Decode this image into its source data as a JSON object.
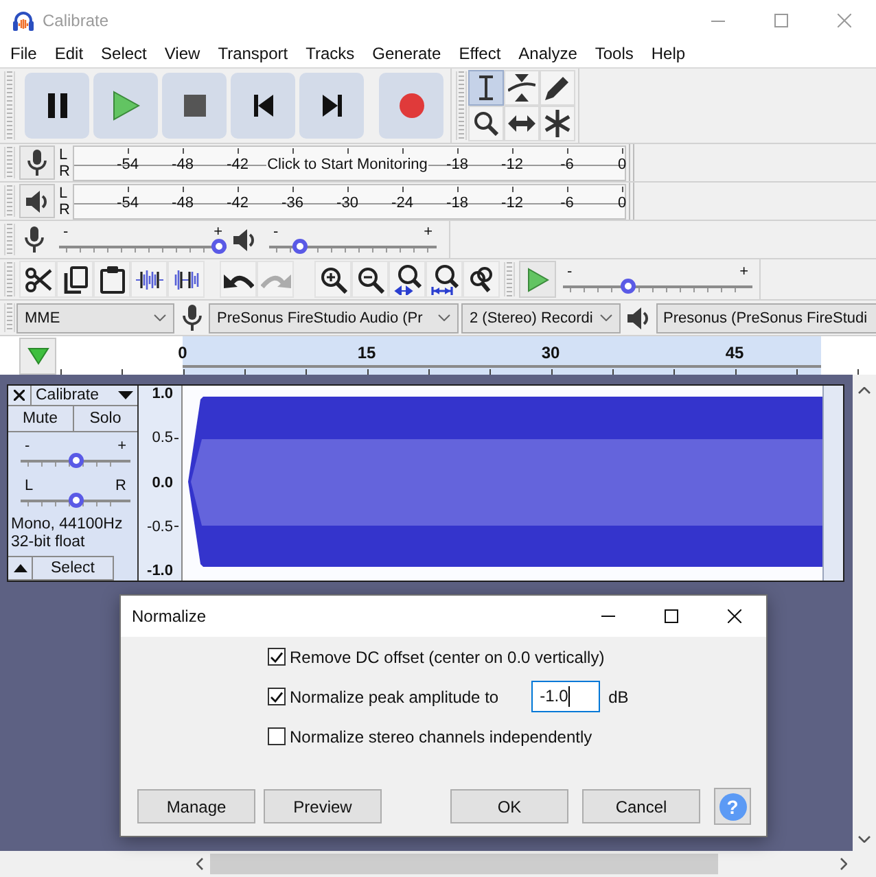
{
  "window": {
    "title": "Calibrate"
  },
  "menu": [
    "File",
    "Edit",
    "Select",
    "View",
    "Transport",
    "Tracks",
    "Generate",
    "Effect",
    "Analyze",
    "Tools",
    "Help"
  ],
  "tools": [
    {
      "kind": "select",
      "selected": true
    },
    {
      "kind": "envelope",
      "selected": false
    },
    {
      "kind": "draw",
      "selected": false
    },
    {
      "kind": "zoom",
      "selected": false
    },
    {
      "kind": "time-shift",
      "selected": false
    },
    {
      "kind": "multi",
      "selected": false
    }
  ],
  "recording_meter": {
    "channels": [
      "L",
      "R"
    ],
    "ticks": [
      "-54",
      "-48",
      "-42"
    ],
    "message": "Click to Start Monitoring",
    "ticks_end": [
      "-18",
      "-12",
      "-6",
      "0"
    ]
  },
  "playback_meter": {
    "channels": [
      "L",
      "R"
    ],
    "ticks": [
      "-54",
      "-48",
      "-42",
      "-36",
      "-30",
      "-24",
      "-18",
      "-12",
      "-6",
      "0"
    ]
  },
  "mixer": {
    "recording_volume": {
      "min_label": "-",
      "max_label": "+",
      "level": 1.0
    },
    "playback_volume": {
      "min_label": "-",
      "max_label": "+",
      "level": 0.15
    }
  },
  "edit_toolbar": [
    {
      "kind": "cut",
      "disabled": false
    },
    {
      "kind": "copy",
      "disabled": false
    },
    {
      "kind": "paste",
      "disabled": false
    },
    {
      "kind": "trim",
      "disabled": false
    },
    {
      "kind": "silence",
      "disabled": false
    },
    {
      "kind": "undo",
      "disabled": false
    },
    {
      "kind": "redo",
      "disabled": true
    },
    {
      "kind": "zoom-in",
      "disabled": false
    },
    {
      "kind": "zoom-out",
      "disabled": false
    },
    {
      "kind": "fit-selection",
      "disabled": false
    },
    {
      "kind": "fit-project",
      "disabled": false
    },
    {
      "kind": "zoom-toggle",
      "disabled": false
    }
  ],
  "play_at_speed": {
    "min_label": "-",
    "max_label": "+",
    "level": 0.33
  },
  "devices": {
    "host": "MME",
    "recording_device": "PreSonus FireStudio Audio (Pr",
    "recording_channels": "2 (Stereo) Recordi",
    "playback_device": "Presonus (PreSonus FireStudi"
  },
  "timeline": {
    "labels": [
      "0",
      "15",
      "30",
      "45"
    ]
  },
  "track": {
    "name": "Calibrate",
    "mute": "Mute",
    "solo": "Solo",
    "gain": {
      "min_label": "-",
      "max_label": "+",
      "level": 0.5
    },
    "pan": {
      "min_label": "L",
      "max_label": "R",
      "level": 0.5
    },
    "info": [
      "Mono, 44100Hz",
      "32-bit float"
    ],
    "select": "Select",
    "scale": [
      "1.0",
      "0.5",
      "0.0",
      "-0.5",
      "-1.0"
    ]
  },
  "dialog": {
    "title": "Normalize",
    "options": [
      {
        "label": "Remove DC offset (center on 0.0 vertically)",
        "checked": true
      },
      {
        "label": "Normalize peak amplitude to",
        "checked": true,
        "value": "-1.0",
        "unit": "dB"
      },
      {
        "label": "Normalize stereo channels independently",
        "checked": false
      }
    ],
    "buttons": [
      "Manage",
      "Preview",
      "OK",
      "Cancel"
    ],
    "help": "?"
  }
}
